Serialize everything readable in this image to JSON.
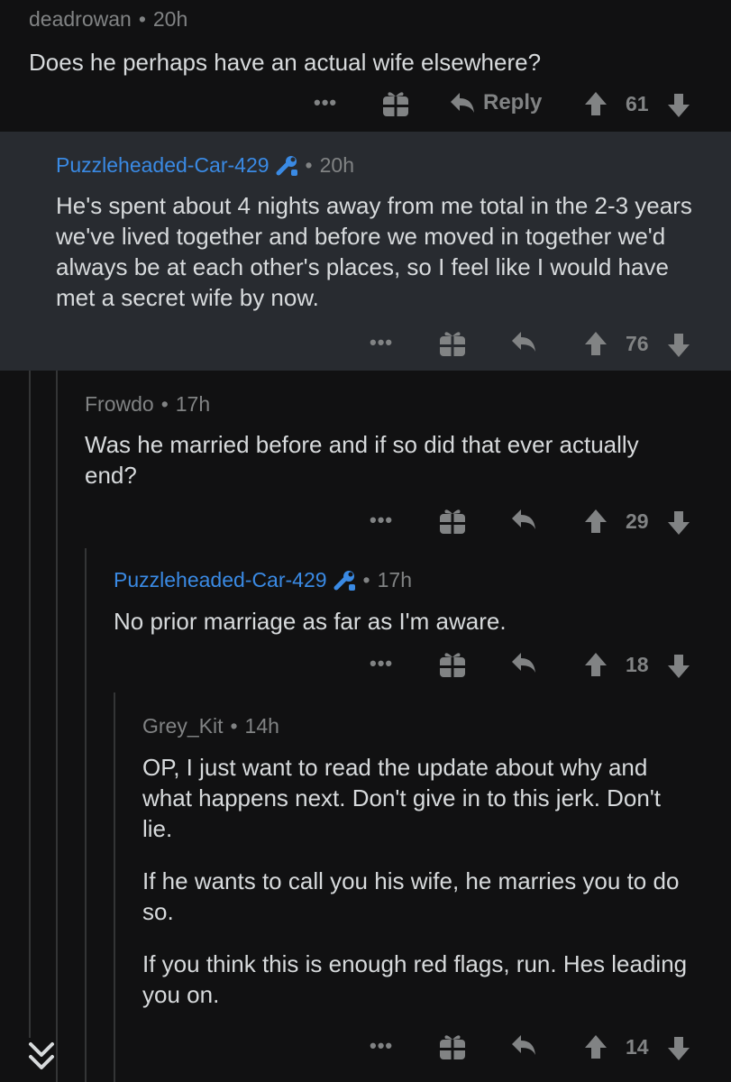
{
  "comments": [
    {
      "username": "deadrowan",
      "age": "20h",
      "paragraphs": [
        "Does he perhaps have an actual wife elsewhere?"
      ],
      "reply_label": "Reply",
      "votes": "61"
    },
    {
      "username": "Puzzleheaded-Car-429",
      "age": "20h",
      "paragraphs": [
        "He's spent about 4 nights away from me total in the 2-3 years we've lived together and before we moved in together we'd always be at each other's places, so I feel like I would have met a secret wife by now."
      ],
      "votes": "76"
    },
    {
      "username": "Frowdo",
      "age": "17h",
      "paragraphs": [
        "Was he married before and if so did that ever actually end?"
      ],
      "votes": "29"
    },
    {
      "username": "Puzzleheaded-Car-429",
      "age": "17h",
      "paragraphs": [
        "No prior marriage as far as I'm aware."
      ],
      "votes": "18"
    },
    {
      "username": "Grey_Kit",
      "age": "14h",
      "paragraphs": [
        "OP, I just want to read the update about why and what happens next. Don't give in to this jerk. Don't lie.",
        "If he wants to call you his wife, he marries you to do so.",
        "If you think this is enough red flags, run. Hes leading you on."
      ],
      "votes": "14"
    }
  ],
  "colors": {
    "background": "#111112",
    "highlight_background": "#282b30",
    "op_username": "#3a8ae4",
    "muted": "#818384",
    "text": "#d7dadc",
    "thread_line": "#343536"
  },
  "icons": [
    "more-icon",
    "award-icon",
    "reply-icon",
    "upvote-icon",
    "downvote-icon",
    "mod-wrench-icon",
    "collapse-chevrons-icon"
  ]
}
